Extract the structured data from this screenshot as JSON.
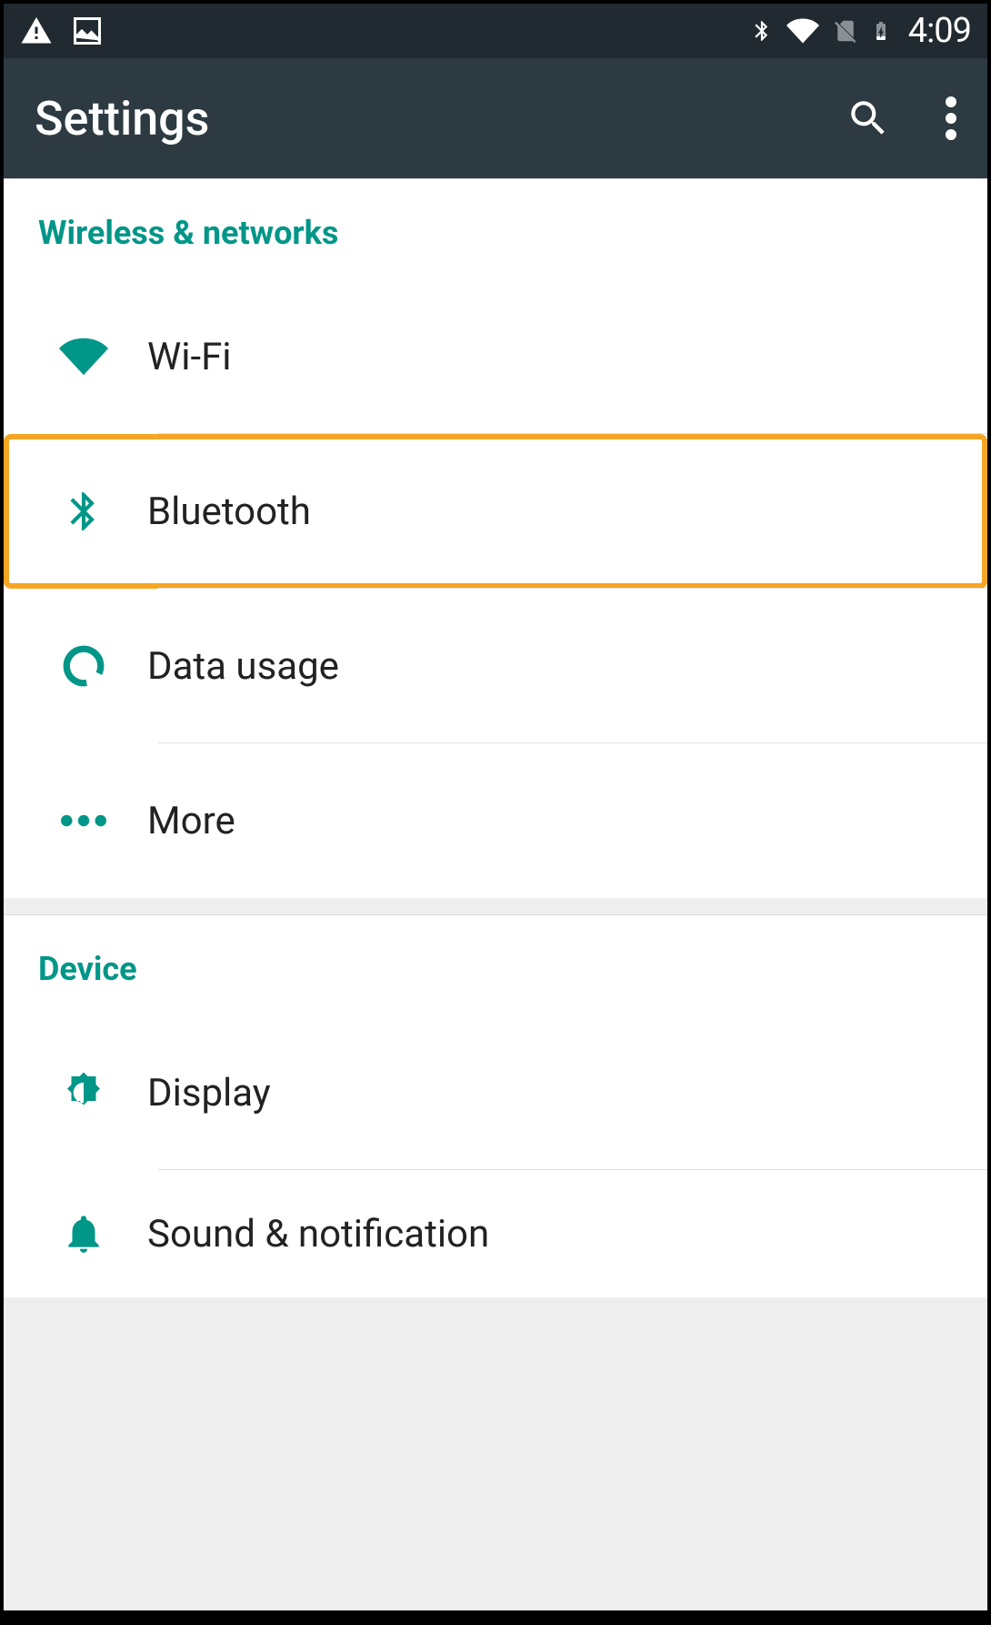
{
  "status": {
    "time": "4:09"
  },
  "appbar": {
    "title": "Settings"
  },
  "sections": [
    {
      "header": "Wireless & networks",
      "items": [
        {
          "label": "Wi-Fi"
        },
        {
          "label": "Bluetooth",
          "highlighted": true
        },
        {
          "label": "Data usage"
        },
        {
          "label": "More"
        }
      ]
    },
    {
      "header": "Device",
      "items": [
        {
          "label": "Display"
        },
        {
          "label": "Sound & notification"
        }
      ]
    }
  ],
  "colors": {
    "accent": "#009688",
    "highlight": "#f5a623",
    "appbar": "#2d3a41",
    "statusbar": "#212a30"
  }
}
